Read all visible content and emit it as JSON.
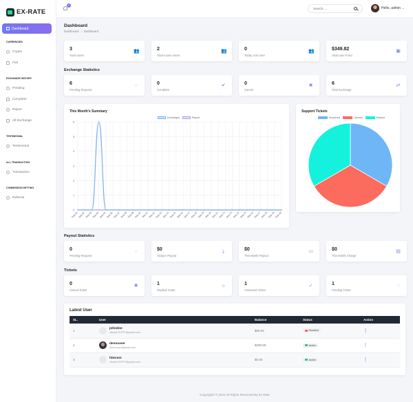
{
  "brand": {
    "name": "EX-RATE"
  },
  "sidebar": {
    "active": "Dashboard",
    "sections": [
      {
        "heading": "CURRENCIES",
        "items": [
          "Crypto",
          "Fiat"
        ]
      },
      {
        "heading": "EXCHANGE HISTORY",
        "items": [
          "Pending",
          "Complete",
          "Reject",
          "All Exchange"
        ]
      },
      {
        "heading": "TESTIMONIAL",
        "items": [
          "Testimonial"
        ]
      },
      {
        "heading": "ALL TRANSACTION",
        "items": [
          "Transaction"
        ]
      },
      {
        "heading": "COMMISSION SETTING",
        "items": [
          "Referral"
        ]
      }
    ]
  },
  "topbar": {
    "notif_count": "0",
    "search_placeholder": "Search....",
    "user_label": "Hello, admin"
  },
  "page": {
    "title": "Dashboard",
    "crumbs": [
      "Dashboard",
      "Dashboard"
    ]
  },
  "top_stats": [
    {
      "value": "3",
      "label": "Total Users",
      "icon": "users-icon"
    },
    {
      "value": "2",
      "label": "Total Active Users",
      "icon": "users-icon"
    },
    {
      "value": "0",
      "label": "Today Join User",
      "icon": "users-icon"
    },
    {
      "value": "$349.82",
      "label": "Total User Fund",
      "icon": "wallet-icon"
    }
  ],
  "exchange": {
    "title": "Exchange Statistics",
    "stats": [
      {
        "value": "6",
        "label": "Pending Request",
        "icon": "spinner-icon"
      },
      {
        "value": "0",
        "label": "Complete",
        "icon": "check-circle-icon"
      },
      {
        "value": "0",
        "label": "Cancel",
        "icon": "cancel-circle-icon"
      },
      {
        "value": "6",
        "label": "Total Exchange",
        "icon": "exchange-icon"
      }
    ]
  },
  "summary": {
    "title": "This Month's Summary",
    "legend": [
      "Exchanges",
      "Payout"
    ]
  },
  "support": {
    "title": "Support Tickets",
    "legend": [
      "Answered",
      "Opened",
      "Replied"
    ]
  },
  "payout": {
    "title": "Payout Statistics",
    "stats": [
      {
        "value": "0",
        "label": "Pending Request",
        "icon": "spinner-icon"
      },
      {
        "value": "$0",
        "label": "Today's Payout",
        "icon": "hand-money-icon"
      },
      {
        "value": "$0",
        "label": "This Month Payout",
        "icon": "money-icon"
      },
      {
        "value": "$0",
        "label": "This Month Charge",
        "icon": "receipt-icon"
      }
    ]
  },
  "tickets": {
    "title": "Tickets",
    "stats": [
      {
        "value": "0",
        "label": "Closed Ticket",
        "icon": "close-circle-icon"
      },
      {
        "value": "1",
        "label": "Replied Ticket",
        "icon": "inbox-icon"
      },
      {
        "value": "1",
        "label": "Answered Ticket",
        "icon": "check-icon"
      },
      {
        "value": "1",
        "label": "Pending Ticket",
        "icon": "spinner-icon"
      }
    ]
  },
  "latest_users": {
    "title": "Latest User",
    "columns": [
      "SL.",
      "User",
      "Balance",
      "Status",
      "Action"
    ],
    "rows": [
      {
        "sl": "1",
        "name": "johndoe",
        "email": "infoddv76TPF@gmail.com",
        "balance": "$60.02",
        "status": "Deactive",
        "status_color": "#e95b4f",
        "photo": false
      },
      {
        "sl": "2",
        "name": "demouser",
        "email": "demouser@gmail.com",
        "balance": "$289.80",
        "status": "Active",
        "status_color": "#2dbe6c",
        "photo": true
      },
      {
        "sl": "3",
        "name": "hiwcam",
        "email": "infoddv76TPF@gmail.com",
        "balance": "$0.00",
        "status": "Active",
        "status_color": "#2dbe6c",
        "photo": false
      }
    ],
    "action_glyph": "⋮"
  },
  "footer": {
    "text": "Copyrights © 2022 All Rights Reserved By Ex-Rate"
  },
  "chart_data": [
    {
      "type": "line",
      "title": "This Month's Summary",
      "x": [
        "Sep-01",
        "Sep-02",
        "Sep-03",
        "Sep-04",
        "Sep-05",
        "Sep-06",
        "Sep-07",
        "Sep-08",
        "Sep-09",
        "Sep-10",
        "Sep-11",
        "Sep-12",
        "Sep-13",
        "Sep-14",
        "Sep-15",
        "Sep-16",
        "Sep-17",
        "Sep-18",
        "Sep-19",
        "Sep-20",
        "Sep-21",
        "Sep-22",
        "Sep-23",
        "Sep-24",
        "Sep-25",
        "Sep-26",
        "Sep-27",
        "Sep-28",
        "Sep-29",
        "Sep-30"
      ],
      "series": [
        {
          "name": "Exchanges",
          "values": [
            0,
            0,
            0,
            6,
            0,
            0,
            0,
            0,
            0,
            0,
            0,
            0,
            0,
            0,
            0,
            0,
            0,
            0,
            0,
            0,
            0,
            0,
            0,
            0,
            0,
            0,
            0,
            0,
            0,
            0
          ]
        },
        {
          "name": "Payout",
          "values": [
            0,
            0,
            0,
            0,
            0,
            0,
            0,
            0,
            0,
            0,
            0,
            0,
            0,
            0,
            0,
            0,
            0,
            0,
            0,
            0,
            0,
            0,
            0,
            0,
            0,
            0,
            0,
            0,
            0,
            0
          ]
        }
      ],
      "ylim": [
        0,
        6
      ],
      "yticks": [
        "0",
        "1",
        "2",
        "3",
        "4",
        "5",
        "6"
      ],
      "grid": true,
      "legend": "top",
      "colors": {
        "Exchanges": "#7fb3f0",
        "Payout": "#a9a3e8"
      }
    },
    {
      "type": "pie",
      "title": "Support Tickets",
      "labels": [
        "Answered",
        "Opened",
        "Replied"
      ],
      "values": [
        1,
        1,
        1
      ],
      "colors": [
        "#6fb6f7",
        "#fb6b5e",
        "#14f2dd"
      ],
      "legend": "top"
    }
  ]
}
